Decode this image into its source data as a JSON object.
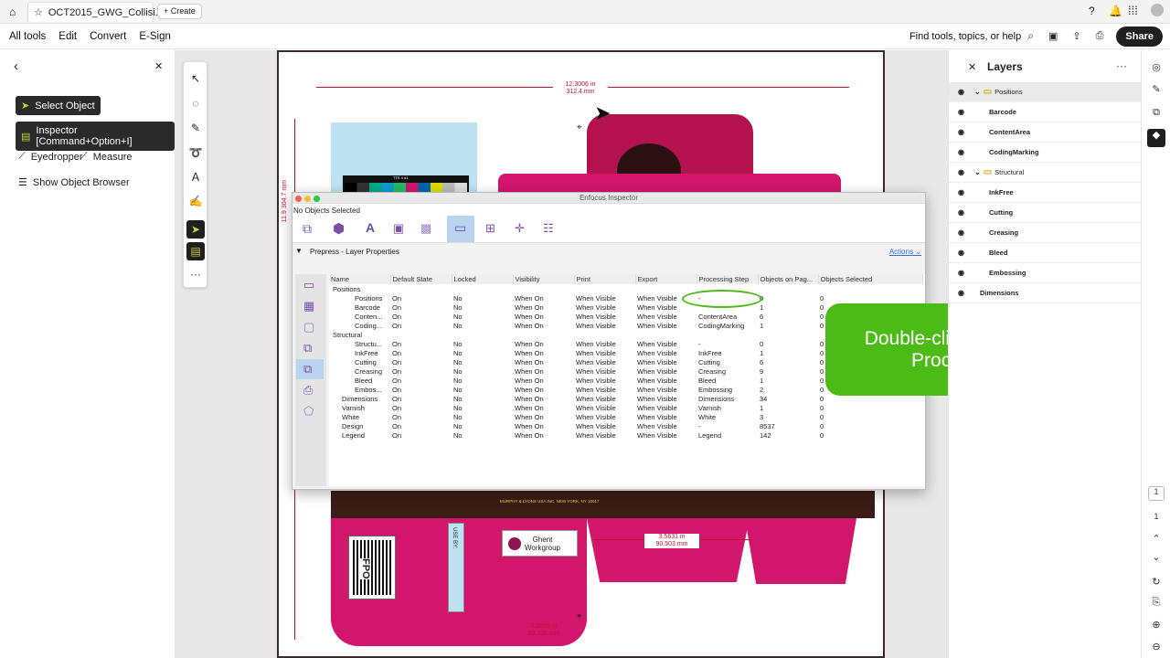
{
  "tab": {
    "title": "OCT2015_GWG_Collisi...",
    "create": "Create"
  },
  "menu": {
    "all_tools": "All tools",
    "edit": "Edit",
    "convert": "Convert",
    "esign": "E-Sign",
    "find": "Find tools, topics, or help",
    "share": "Share"
  },
  "left": {
    "select_object": "Select Object",
    "inspector": "Inspector [Command+Option+I]",
    "eyedropper": "Eyedropper",
    "measure": "Measure",
    "show_browser": "Show Object Browser"
  },
  "page": {
    "dim_top_a": "12.3006 in",
    "dim_top_b": "312.4 mm",
    "dim_side_a": "11.9",
    "dim_side_b": "304.7 mm",
    "dim_mid_a": "3.5631 in",
    "dim_mid_b": "90.503 mm",
    "dim_bot_a": "2.3663 in",
    "dim_bot_b": "60.105 mm",
    "box_text": "MURPHY & LYONS USA INC, NEW YORK, NY 10017",
    "color_bar_label": "TTS 4 #1",
    "use_by": "USE BY:",
    "logo_line1": "Ghent",
    "logo_line2": "Workgroup",
    "fpo": "FPO"
  },
  "inspector": {
    "window_title": "Enfocus Inspector",
    "status": "No Objects Selected",
    "section": "Prepress - Layer Properties",
    "actions": "Actions",
    "columns": [
      "Name",
      "Default State",
      "Locked",
      "Visibility",
      "Print",
      "Export",
      "Processing Step",
      "Objects on Pag...",
      "Objects Selected"
    ],
    "rows": [
      [
        "Positions",
        "",
        "",
        "",
        "",
        "",
        "",
        "",
        ""
      ],
      [
        "Positions",
        "On",
        "No",
        "When On",
        "When Visible",
        "When Visible",
        "-",
        "0",
        "0"
      ],
      [
        "Barcode",
        "On",
        "No",
        "When On",
        "When Visible",
        "When Visible",
        "",
        "1",
        "0"
      ],
      [
        "Conten...",
        "On",
        "No",
        "When On",
        "When Visible",
        "When Visible",
        "ContentArea",
        "6",
        "0"
      ],
      [
        "Coding...",
        "On",
        "No",
        "When On",
        "When Visible",
        "When Visible",
        "CodingMarking",
        "1",
        "0"
      ],
      [
        "Structural",
        "",
        "",
        "",
        "",
        "",
        "",
        "",
        ""
      ],
      [
        "Structu...",
        "On",
        "No",
        "When On",
        "When Visible",
        "When Visible",
        "-",
        "0",
        "0"
      ],
      [
        "InkFree",
        "On",
        "No",
        "When On",
        "When Visible",
        "When Visible",
        "InkFree",
        "1",
        "0"
      ],
      [
        "Cutting",
        "On",
        "No",
        "When On",
        "When Visible",
        "When Visible",
        "Cutting",
        "6",
        "0"
      ],
      [
        "Creasing",
        "On",
        "No",
        "When On",
        "When Visible",
        "When Visible",
        "Creasing",
        "9",
        "0"
      ],
      [
        "Bleed",
        "On",
        "No",
        "When On",
        "When Visible",
        "When Visible",
        "Bleed",
        "1",
        "0"
      ],
      [
        "Embos...",
        "On",
        "No",
        "When On",
        "When Visible",
        "When Visible",
        "Embossing",
        "2",
        "0"
      ],
      [
        "Dimensions",
        "On",
        "No",
        "When On",
        "When Visible",
        "When Visible",
        "Dimensions",
        "34",
        "0"
      ],
      [
        "Varnish",
        "On",
        "No",
        "When On",
        "When Visible",
        "When Visible",
        "Varnish",
        "1",
        "0"
      ],
      [
        "White",
        "On",
        "No",
        "When On",
        "When Visible",
        "When Visible",
        "White",
        "3",
        "0"
      ],
      [
        "Design",
        "On",
        "No",
        "When On",
        "When Visible",
        "When Visible",
        "-",
        "8537",
        "0"
      ],
      [
        "Legend",
        "On",
        "No",
        "When On",
        "When Visible",
        "When Visible",
        "Legend",
        "142",
        "0"
      ]
    ]
  },
  "layers": {
    "title": "Layers",
    "items": [
      "Positions",
      "Barcode",
      "ContentArea",
      "CodingMarking",
      "Structural",
      "InkFree",
      "Cutting",
      "Creasing",
      "Bleed",
      "Embossing",
      "Dimensions"
    ]
  },
  "callout": {
    "text": "Double-click to get the list of Processing steps"
  },
  "pager": {
    "current": "1",
    "total": "1"
  }
}
